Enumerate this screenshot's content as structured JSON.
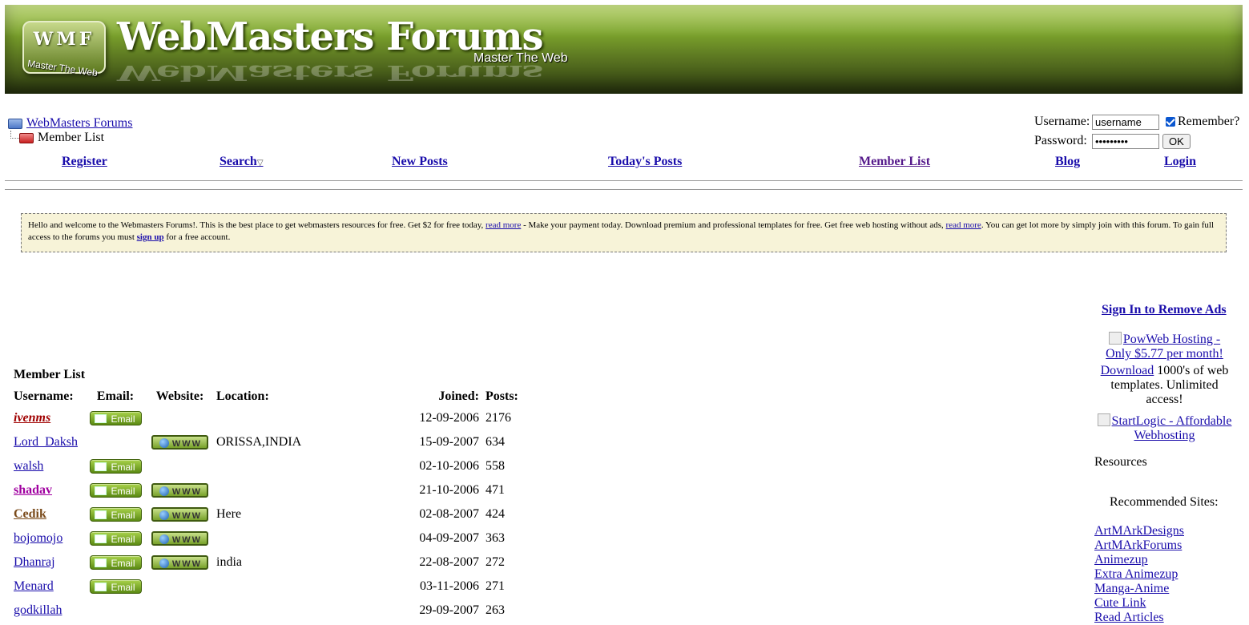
{
  "header": {
    "logo_text": "WMF",
    "logo_tagline": "Master The Web",
    "site_title": "WebMasters Forums",
    "tagline": "Master The Web"
  },
  "breadcrumb": {
    "root": "WebMasters Forums",
    "current": "Member List"
  },
  "login": {
    "username_label": "Username:",
    "username_value": "username",
    "remember_label": "Remember?",
    "password_label": "Password:",
    "password_value": "passwords",
    "ok_label": "OK"
  },
  "nav": {
    "register": "Register",
    "search": "Search",
    "new_posts": "New Posts",
    "todays_posts": "Today's Posts",
    "member_list": "Member List",
    "blog": "Blog",
    "login": "Login"
  },
  "welcome": {
    "text1": "Hello and welcome to the Webmasters Forums!. This is the best place to get webmasters resources for free. Get $2 for free today, ",
    "link1": "read more",
    "text2": " - Make your payment today. Download premium and professional templates for free. Get free web hosting without ads, ",
    "link2": "read more",
    "text3": ". You can get lot more by simply join with this forum. To gain full access to the forums you must ",
    "link3": "sign up",
    "text4": " for a free account."
  },
  "member_list": {
    "title": "Member List",
    "columns": {
      "username": "Username:",
      "email": "Email:",
      "website": "Website:",
      "location": "Location:",
      "joined": "Joined:",
      "posts": "Posts:"
    },
    "email_button": "Email",
    "www_button": "WWW",
    "rows": [
      {
        "username": "ivenms",
        "email": true,
        "website": false,
        "location": "",
        "joined": "12-09-2006",
        "posts": "2176"
      },
      {
        "username": "Lord_Daksh",
        "email": false,
        "website": true,
        "location": "ORISSA,INDIA",
        "joined": "15-09-2007",
        "posts": "634"
      },
      {
        "username": "walsh",
        "email": true,
        "website": false,
        "location": "",
        "joined": "02-10-2006",
        "posts": "558"
      },
      {
        "username": "shadav",
        "email": true,
        "website": true,
        "location": "",
        "joined": "21-10-2006",
        "posts": "471"
      },
      {
        "username": "Cedik",
        "email": true,
        "website": true,
        "location": "Here",
        "joined": "02-08-2007",
        "posts": "424"
      },
      {
        "username": "bojomojo",
        "email": true,
        "website": true,
        "location": "",
        "joined": "04-09-2007",
        "posts": "363"
      },
      {
        "username": "Dhanraj",
        "email": true,
        "website": true,
        "location": "india",
        "joined": "22-08-2007",
        "posts": "272"
      },
      {
        "username": "Menard",
        "email": true,
        "website": false,
        "location": "",
        "joined": "03-11-2006",
        "posts": "271"
      },
      {
        "username": "godkillah",
        "email": false,
        "website": false,
        "location": "",
        "joined": "29-09-2007",
        "posts": "263"
      }
    ]
  },
  "sidebar": {
    "sign_in_remove_ads": "Sign In to Remove Ads",
    "ad1": "PowWeb Hosting - Only $5.77 per month!",
    "download_link": "Download",
    "download_text": " 1000's of web templates. Unlimited access!",
    "ad2": "StartLogic - Affordable Webhosting",
    "resources": "Resources",
    "recommended": "Recommended Sites:",
    "links": [
      "ArtMArkDesigns",
      "ArtMArkForums",
      "Animezup",
      "Extra Animezup",
      "Manga-Anime",
      "Cute Link",
      "Read Articles"
    ]
  }
}
